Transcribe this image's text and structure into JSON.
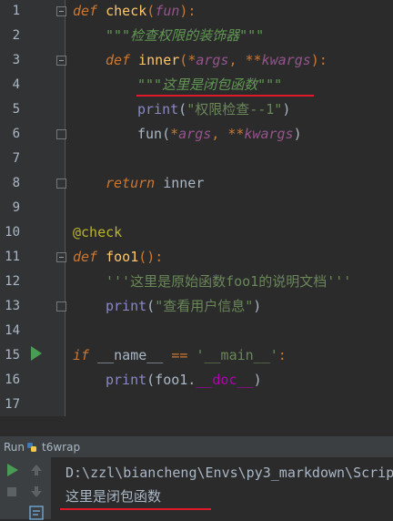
{
  "editor": {
    "line_numbers": [
      "1",
      "2",
      "3",
      "4",
      "5",
      "6",
      "7",
      "8",
      "9",
      "10",
      "11",
      "12",
      "13",
      "14",
      "15",
      "16",
      "17"
    ],
    "lines": {
      "l1": {
        "kw": "def",
        "fn": "check",
        "open": "(",
        "param": "fun",
        "close": "):"
      },
      "l2": {
        "doc": "\"\"\"检查权限的装饰器\"\"\""
      },
      "l3": {
        "kw": "def",
        "fn": "inner",
        "open": "(",
        "star1": "*",
        "args": "args",
        "comma": ", ",
        "star2": "**",
        "kwargs": "kwargs",
        "close": "):"
      },
      "l4": {
        "doc": "\"\"\"这里是闭包函数\"\"\""
      },
      "l5": {
        "builtin": "print",
        "open": "(",
        "str": "\"权限检查--1\"",
        "close": ")"
      },
      "l6": {
        "call": "fun",
        "open": "(",
        "star1": "*",
        "args": "args",
        "comma": ", ",
        "star2": "**",
        "kwargs": "kwargs",
        "close": ")"
      },
      "l8": {
        "kw": "return",
        "rest": " inner"
      },
      "l10": {
        "deco": "@check"
      },
      "l11": {
        "kw": "def",
        "fn": "foo1",
        "close": "():"
      },
      "l12": {
        "doc": "'''这里是原始函数foo1的说明文档'''"
      },
      "l13": {
        "builtin": "print",
        "open": "(",
        "str": "\"查看用户信息\"",
        "close": ")"
      },
      "l15": {
        "kw": "if",
        "name": " __name__ ",
        "op": "==",
        "str": " '__main__'",
        "colon": ":"
      },
      "l16": {
        "builtin": "print",
        "open": "(foo1.",
        "magic": "__doc__",
        "close": ")"
      }
    }
  },
  "run_panel": {
    "tab_label": "Run",
    "config_name": "t6wrap",
    "console": {
      "command": "D:\\zzl\\biancheng\\Envs\\py3_markdown\\Scrip",
      "output": "这里是闭包函数"
    }
  }
}
